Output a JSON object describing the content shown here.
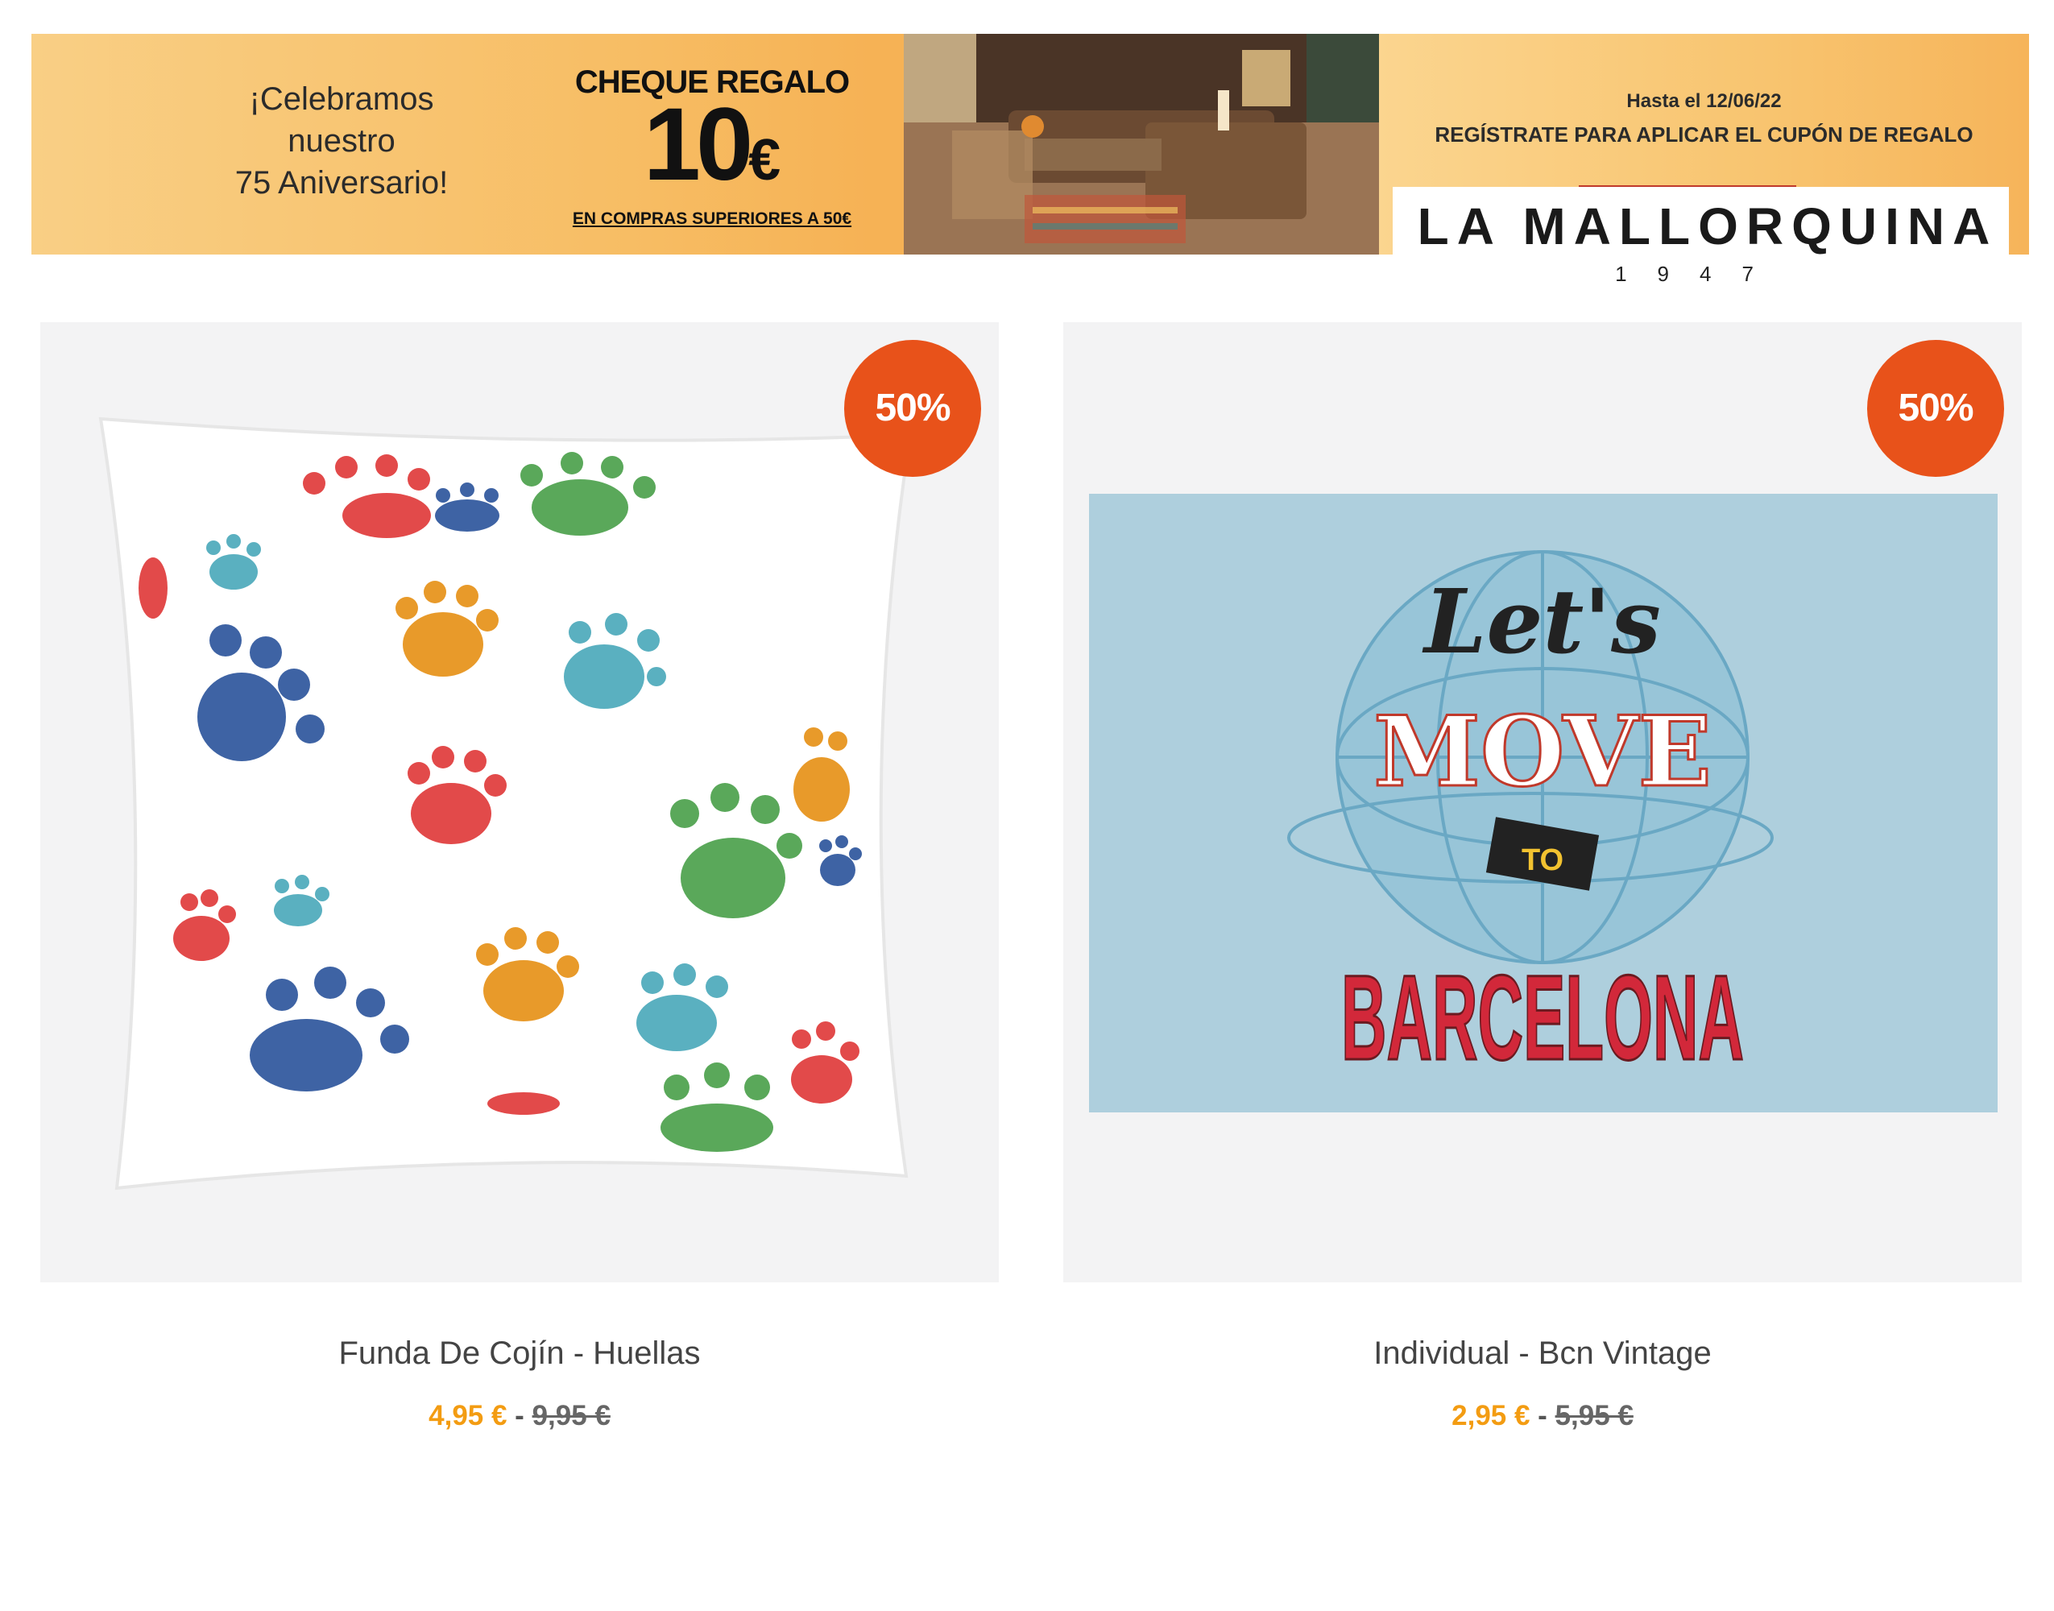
{
  "banner": {
    "celebrate_line1": "¡Celebramos",
    "celebrate_line2": "nuestro",
    "celebrate_line3": "75 Aniversario!",
    "cheque_title": "CHEQUE REGALO",
    "cheque_amount": "10",
    "cheque_currency": "€",
    "cheque_condition": "EN COMPRAS SUPERIORES A 50€",
    "promo_date": "Hasta el 12/06/22",
    "promo_text": "REGÍSTRATE PARA APLICAR EL CUPÓN DE REGALO",
    "brand_name": "LA MALLORQUINA",
    "brand_year": "1947"
  },
  "products": [
    {
      "name": "Funda De Cojín - Huellas",
      "discount_badge": "50%",
      "price_new": "4,95 €",
      "separator": "-",
      "price_old": "9,95 €",
      "image_icon": "paw-print-cushion-image"
    },
    {
      "name": "Individual - Bcn Vintage",
      "discount_badge": "50%",
      "price_new": "2,95 €",
      "separator": "-",
      "price_old": "5,95 €",
      "image_icon": "placemat-barcelona-image",
      "image_text_1": "Let's",
      "image_text_2": "MOVE",
      "image_text_3": "TO",
      "image_text_4": "BARCELONA"
    }
  ],
  "colors": {
    "badge": "#e8521a",
    "price_new": "#f39c12",
    "banner": "#f7bd64"
  }
}
